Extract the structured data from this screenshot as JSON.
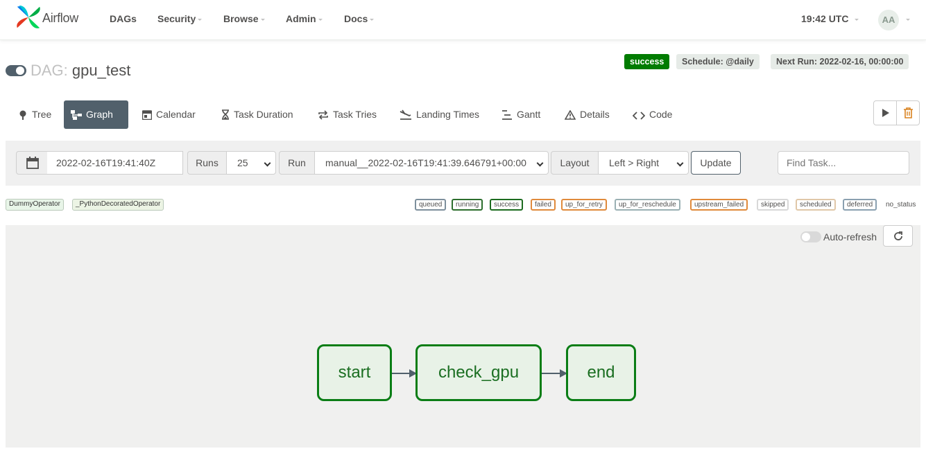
{
  "navbar": {
    "brand": "Airflow",
    "items": [
      {
        "label": "DAGs"
      },
      {
        "label": "Security"
      },
      {
        "label": "Browse"
      },
      {
        "label": "Admin"
      },
      {
        "label": "Docs"
      }
    ],
    "clock": "19:42 UTC",
    "user_initials": "AA"
  },
  "dag": {
    "prefix": "DAG:",
    "name": "gpu_test",
    "paused": false,
    "status": "success",
    "schedule": "Schedule: @daily",
    "next_run": "Next Run: 2022-02-16, 00:00:00"
  },
  "tabs": [
    {
      "label": "Tree",
      "icon": "tree-icon"
    },
    {
      "label": "Graph",
      "icon": "graph-icon",
      "active": true
    },
    {
      "label": "Calendar",
      "icon": "calendar-icon"
    },
    {
      "label": "Task Duration",
      "icon": "hourglass-icon"
    },
    {
      "label": "Task Tries",
      "icon": "repeat-icon"
    },
    {
      "label": "Landing Times",
      "icon": "plane-landing-icon"
    },
    {
      "label": "Gantt",
      "icon": "gantt-icon"
    },
    {
      "label": "Details",
      "icon": "warning-triangle-icon"
    },
    {
      "label": "Code",
      "icon": "code-icon"
    }
  ],
  "controls": {
    "base_date": "2022-02-16T19:41:40Z",
    "runs_label": "Runs",
    "runs_value": "25",
    "run_label": "Run",
    "run_value": "manual__2022-02-16T19:41:39.646791+00:00",
    "layout_label": "Layout",
    "layout_value": "Left > Right",
    "update_label": "Update",
    "find_task_placeholder": "Find Task..."
  },
  "operators": [
    {
      "label": "DummyOperator"
    },
    {
      "label": "_PythonDecoratedOperator"
    }
  ],
  "states": [
    {
      "label": "queued",
      "color": "#808080"
    },
    {
      "label": "running",
      "color": "#00a000"
    },
    {
      "label": "success",
      "color": "#008000"
    },
    {
      "label": "failed",
      "color": "#ff0000"
    },
    {
      "label": "up_for_retry",
      "color": "#ffa500"
    },
    {
      "label": "up_for_reschedule",
      "color": "#40e0d0"
    },
    {
      "label": "upstream_failed",
      "color": "#ffa500"
    },
    {
      "label": "skipped",
      "color": "#ff69b4"
    },
    {
      "label": "scheduled",
      "color": "#d2b48c"
    },
    {
      "label": "deferred",
      "color": "#9370db"
    },
    {
      "label": "no_status",
      "color": "#ffffff"
    }
  ],
  "graph": {
    "auto_refresh_label": "Auto-refresh",
    "nodes": [
      {
        "label": "start"
      },
      {
        "label": "check_gpu"
      },
      {
        "label": "end"
      }
    ]
  },
  "colors": {
    "success": "#017c01",
    "accent": "#51606b",
    "node_border": "#0a7d15"
  }
}
